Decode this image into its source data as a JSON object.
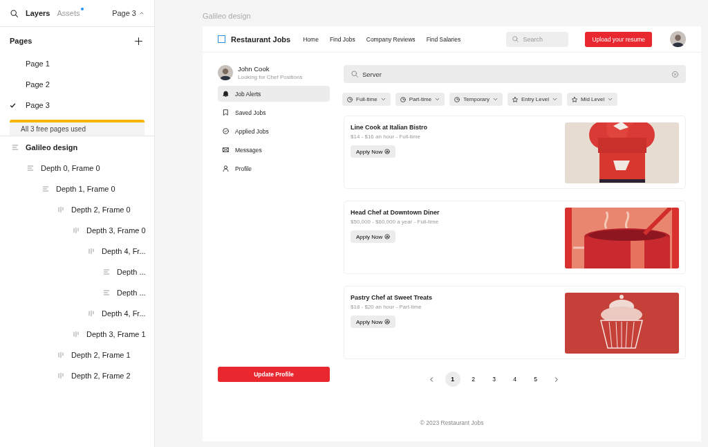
{
  "panel": {
    "tabs": [
      {
        "label": "Layers",
        "selected": true,
        "notification": false
      },
      {
        "label": "Assets",
        "selected": false,
        "notification": true
      }
    ],
    "page_switcher": "Page 3",
    "pages_title": "Pages",
    "pages": [
      {
        "label": "Page 1",
        "selected": false
      },
      {
        "label": "Page 2",
        "selected": false
      },
      {
        "label": "Page 3",
        "selected": true
      }
    ],
    "notice": "All 3 free pages used",
    "layers": [
      {
        "name": "Galileo design",
        "kind": "column",
        "children": [
          {
            "name": "Depth 0, Frame 0",
            "kind": "column",
            "children": [
              {
                "name": "Depth 1, Frame 0",
                "kind": "column",
                "children": [
                  {
                    "name": "Depth 2, Frame 0",
                    "kind": "row",
                    "children": [
                      {
                        "name": "Depth 3, Frame 0",
                        "kind": "row",
                        "children": [
                          {
                            "name": "Depth 4, Fr...",
                            "kind": "row",
                            "children": [
                              {
                                "name": "Depth ...",
                                "kind": "column"
                              },
                              {
                                "name": "Depth ...",
                                "kind": "column"
                              }
                            ]
                          },
                          {
                            "name": "Depth 4, Fr...",
                            "kind": "row"
                          }
                        ]
                      },
                      {
                        "name": "Depth 3, Frame 1",
                        "kind": "row"
                      }
                    ]
                  },
                  {
                    "name": "Depth 2, Frame 1",
                    "kind": "row"
                  },
                  {
                    "name": "Depth 2, Frame 2",
                    "kind": "row"
                  }
                ]
              }
            ]
          }
        ]
      }
    ]
  },
  "frame_label": "Galileo design",
  "site": {
    "brand": "Restaurant Jobs",
    "nav": [
      "Home",
      "Find Jobs",
      "Company Reviews",
      "Find Salaries"
    ],
    "search_placeholder": "Search",
    "upload_button": "Upload your resume",
    "profile": {
      "name": "John Cook",
      "subtitle": "Looking for Chef Positions"
    },
    "menu": [
      {
        "label": "Job Alerts",
        "selected": true
      },
      {
        "label": "Saved Jobs",
        "selected": false
      },
      {
        "label": "Applied Jobs",
        "selected": false
      },
      {
        "label": "Messages",
        "selected": false
      },
      {
        "label": "Profile",
        "selected": false
      }
    ],
    "update_button": "Update Profile",
    "job_search": "Server",
    "filters": [
      {
        "label": "Full-time",
        "kind": "type"
      },
      {
        "label": "Part-time",
        "kind": "type"
      },
      {
        "label": "Temporary",
        "kind": "type"
      },
      {
        "label": "Entry Level",
        "kind": "level"
      },
      {
        "label": "Mid Level",
        "kind": "level"
      }
    ],
    "jobs": [
      {
        "title": "Line Cook at Italian Bistro",
        "details": "$14 - $16 an hour - Full-time",
        "button": "Apply Now"
      },
      {
        "title": "Head Chef at Downtown Diner",
        "details": "$50,000 - $60,000 a year - Full-time",
        "button": "Apply Now"
      },
      {
        "title": "Pastry Chef at Sweet Treats",
        "details": "$18 - $20 an hour - Part-time",
        "button": "Apply Now"
      }
    ],
    "pages": [
      {
        "label": "1",
        "selected": true
      },
      {
        "label": "2",
        "selected": false
      },
      {
        "label": "3",
        "selected": false
      },
      {
        "label": "4",
        "selected": false
      },
      {
        "label": "5",
        "selected": false
      }
    ],
    "footer": "© 2023 Restaurant Jobs"
  }
}
